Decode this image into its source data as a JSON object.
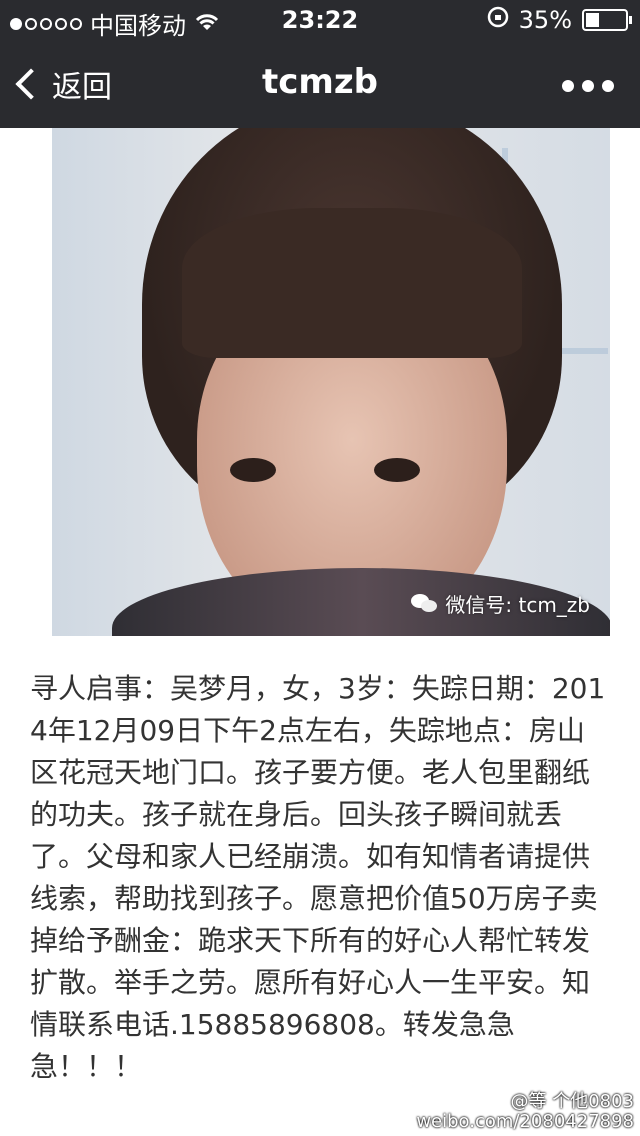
{
  "status_bar": {
    "carrier": "中国移动",
    "time": "23:22",
    "battery": "35%",
    "battery_level": 0.35
  },
  "nav": {
    "back_label": "返回",
    "title": "tcmzb"
  },
  "photo": {
    "watermark": "微信号: tcm_zb"
  },
  "article": {
    "text": "寻人启事：吴梦月，女，3岁：失踪日期：2014年12月09日下午2点左右，失踪地点：房山区花冠天地门口。孩子要方便。老人包里翻纸的功夫。孩子就在身后。回头孩子瞬间就丢了。父母和家人已经崩溃。如有知情者请提供线索，帮助找到孩子。愿意把价值50万房子卖掉给予酬金：跪求天下所有的好心人帮忙转发扩散。举手之劳。愿所有好心人一生平安。知情联系电话.15885896808。转发急急急！！！"
  },
  "weibo_watermark": {
    "line1": "@等 个他0803",
    "line2": "weibo.com/2080427898"
  }
}
